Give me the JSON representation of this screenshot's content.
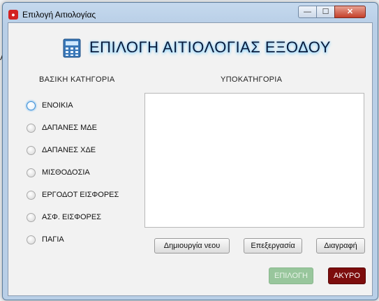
{
  "window": {
    "title": "Επιλογή Αιτιολογίας",
    "controls": {
      "minimize": "—",
      "maximize": "☐",
      "close": "✕"
    }
  },
  "background_app": {
    "edge_text": "A"
  },
  "header": {
    "icon": "calculator-icon",
    "title": "ΕΠΙΛΟΓΗ ΑΙΤΙΟΛΟΓΙΑΣ ΕΞΟΔΟΥ"
  },
  "main_category": {
    "label": "ΒΑΣΙΚΗ ΚΑΤΗΓΟΡΙΑ",
    "options": [
      {
        "label": "ΕΝΟΙΚΙΑ",
        "focused": true,
        "selected": false
      },
      {
        "label": "ΔΑΠΑΝΕΣ ΜΔΕ",
        "focused": false,
        "selected": false
      },
      {
        "label": "ΔΑΠΑΝΕΣ ΧΔΕ",
        "focused": false,
        "selected": false
      },
      {
        "label": "ΜΙΣΘΟΔΟΣΙΑ",
        "focused": false,
        "selected": false
      },
      {
        "label": "ΕΡΓΟΔΟΤ ΕΙΣΦΟΡΕΣ",
        "focused": false,
        "selected": false
      },
      {
        "label": "ΑΣΦ. ΕΙΣΦΟΡΕΣ",
        "focused": false,
        "selected": false
      },
      {
        "label": "ΠΑΓΙΑ",
        "focused": false,
        "selected": false
      }
    ]
  },
  "sub_category": {
    "label": "ΥΠΟΚΑΤΗΓΟΡΙΑ",
    "items": []
  },
  "actions": {
    "new": "Δημιουργία νεου",
    "edit": "Επεξεργασία",
    "delete": "Διαγραφή",
    "select": "ΕΠΙΛΟΓΗ",
    "cancel": "ΑΚΥΡΟ"
  },
  "colors": {
    "select_button_disabled": "#98c69c",
    "cancel_button": "#7d0d0d",
    "title_glow": "#7fd0ff"
  }
}
